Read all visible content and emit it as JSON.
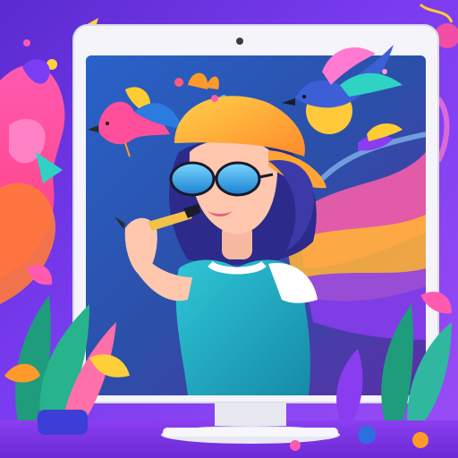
{
  "colors": {
    "background_purple": "#6a33e0",
    "pink_splash": "#ff4fa0",
    "orange": "#ff9a2a",
    "yellow": "#ffd23f",
    "teal": "#1ec6c9",
    "blue": "#2b6fe0",
    "monitor_white": "#f3f3f8"
  },
  "icons": {
    "monitor": "monitor-icon",
    "camera": "webcam-dot",
    "bird": "bird-icon",
    "cap": "cap-icon",
    "sunglasses": "sunglasses-icon",
    "paintbrush": "paintbrush-icon",
    "plant": "plant-icon",
    "sun": "sun-icon"
  }
}
